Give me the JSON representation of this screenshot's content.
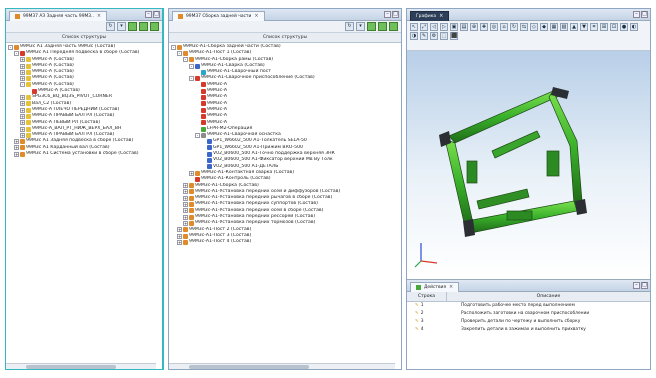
{
  "left_panel": {
    "tab_title": "99М37 АЗ Задняя часть 99М3..",
    "column_header": "Список структуры",
    "rows": [
      {
        "depth": 0,
        "icon": "orange",
        "exp": "-",
        "label": "99М3с А1 Задняя часть 99М3с (Состав)"
      },
      {
        "depth": 1,
        "icon": "red",
        "exp": "-",
        "label": "99М3с А1 Передняя подвеска в сборе (Состав)"
      },
      {
        "depth": 2,
        "icon": "yellow",
        "exp": "+",
        "label": "99М3с-А (Состав)"
      },
      {
        "depth": 2,
        "icon": "yellow",
        "exp": "+",
        "label": "99М3с-А (Состав)"
      },
      {
        "depth": 2,
        "icon": "yellow",
        "exp": "+",
        "label": "99М3с-А (Состав)"
      },
      {
        "depth": 2,
        "icon": "yellow",
        "exp": "+",
        "label": "99М3с-А (Состав)"
      },
      {
        "depth": 2,
        "icon": "yellow",
        "exp": "-",
        "label": "99М3с-А (Состав)"
      },
      {
        "depth": 3,
        "icon": "red",
        "exp": "",
        "label": "99М3с-А (Состав)"
      },
      {
        "depth": 2,
        "icon": "yellow",
        "exp": "+",
        "label": "SPG3С6_BQ_BQ3S_PIVOT_CORNER"
      },
      {
        "depth": 2,
        "icon": "yellow",
        "exp": "+",
        "label": "Вал_С2 (Состав)"
      },
      {
        "depth": 2,
        "icon": "yellow",
        "exp": "+",
        "label": "99М3с-А ПЛЕЧО ПЕРЕДНИЙ (Состав)"
      },
      {
        "depth": 2,
        "icon": "yellow",
        "exp": "+",
        "label": "99М3с-А ПРАВЫЙ БАЛ РЛ (Состав)"
      },
      {
        "depth": 2,
        "icon": "yellow",
        "exp": "+",
        "label": "99М3с-А ЛЕВЫЙ РЛ (Состав)"
      },
      {
        "depth": 2,
        "icon": "yellow",
        "exp": "+",
        "label": "99М3с-А_ВАЛ_РТ_НИЖ_ВЕРХ_БАЛ_ВН"
      },
      {
        "depth": 2,
        "icon": "yellow",
        "exp": "+",
        "label": "99М3с-А ПРАВЫЙ БАЛ РЛ (Состав)"
      },
      {
        "depth": 1,
        "icon": "orange",
        "exp": "+",
        "label": "99М3с А1 Задняя подвеска в сборе (Состав)"
      },
      {
        "depth": 1,
        "icon": "orange",
        "exp": "+",
        "label": "99М3с А1 Карданный вал (Состав)"
      },
      {
        "depth": 1,
        "icon": "orange",
        "exp": "+",
        "label": "99М3с А1 Система установки в сборе (Состав)"
      }
    ]
  },
  "mid_panel": {
    "tab_title": "99М37 Сборка задней части",
    "column_header": "Список структуры",
    "rows": [
      {
        "depth": 0,
        "icon": "orange",
        "exp": "-",
        "label": "99М3с-А1-Сборка задней части (Состав)"
      },
      {
        "depth": 1,
        "icon": "orange",
        "exp": "-",
        "label": "99М3с-А1-Пост 1 (Состав)"
      },
      {
        "depth": 2,
        "icon": "orange",
        "exp": "-",
        "label": "99М3с-А1-Сборка рамы (Состав)"
      },
      {
        "depth": 3,
        "icon": "blue",
        "exp": "-",
        "label": "99М3с-А1-Сварка (Состав)"
      },
      {
        "depth": 4,
        "icon": "cyan",
        "exp": "",
        "label": "99М3с-А1-Сварочный пост"
      },
      {
        "depth": 3,
        "icon": "red",
        "exp": "-",
        "label": "99М3с-А1-Сварочное приспособление (Состав)"
      },
      {
        "depth": 4,
        "icon": "red",
        "exp": "",
        "label": "99М3с-А"
      },
      {
        "depth": 4,
        "icon": "red",
        "exp": "",
        "label": "99М3с-А"
      },
      {
        "depth": 4,
        "icon": "red",
        "exp": "",
        "label": "99М3с-А"
      },
      {
        "depth": 4,
        "icon": "red",
        "exp": "",
        "label": "99М3с-А"
      },
      {
        "depth": 4,
        "icon": "red",
        "exp": "",
        "label": "99М3с-А"
      },
      {
        "depth": 4,
        "icon": "red",
        "exp": "",
        "label": "99М3с-А"
      },
      {
        "depth": 4,
        "icon": "red",
        "exp": "",
        "label": "99М3с-А"
      },
      {
        "depth": 4,
        "icon": "green",
        "exp": "",
        "label": "LFPR-М2-Операция"
      },
      {
        "depth": 4,
        "icon": "gray",
        "exp": "-",
        "label": "99М3с-А1-Сварочная оснастка"
      },
      {
        "depth": 5,
        "icon": "blue",
        "exp": "",
        "label": "GP1_W6602_500 А1-Толкатель SELA-50"
      },
      {
        "depth": 5,
        "icon": "blue",
        "exp": "",
        "label": "GP1_W6602_500 А1-Прижим BRO-500"
      },
      {
        "depth": 5,
        "icon": "blue",
        "exp": "",
        "label": "V02_B0600_500 А1-Точно поддержка верхняя ЗНК"
      },
      {
        "depth": 5,
        "icon": "blue",
        "exp": "",
        "label": "V02_B0600_500 А1-Фиксатор верхний Мв Ву Толк"
      },
      {
        "depth": 5,
        "icon": "blue",
        "exp": "",
        "label": "V02_B0600_500 А1-ДЕТАЛЬ"
      },
      {
        "depth": 3,
        "icon": "orange",
        "exp": "+",
        "label": "99М3с-А1-Контактная сварка (Состав)"
      },
      {
        "depth": 3,
        "icon": "red",
        "exp": "",
        "label": "99М3с-А1-Контроль (Состав)"
      },
      {
        "depth": 2,
        "icon": "orange",
        "exp": "+",
        "label": "99М3с-А1-Сборка (Состав)"
      },
      {
        "depth": 2,
        "icon": "orange",
        "exp": "+",
        "label": "99М3с-А1-Установка передних осей и диффузоров (Состав)"
      },
      {
        "depth": 2,
        "icon": "orange",
        "exp": "+",
        "label": "99М3с-А1-Установка передних рычагов в сборе (Состав)"
      },
      {
        "depth": 2,
        "icon": "orange",
        "exp": "+",
        "label": "99М3с-А1-Установка передних суппортов (Состав)"
      },
      {
        "depth": 2,
        "icon": "orange",
        "exp": "+",
        "label": "99М3с-А1-Установка передних осей в сборе (Состав)"
      },
      {
        "depth": 2,
        "icon": "orange",
        "exp": "+",
        "label": "99М3с-А1-Установка передних рессорей (Состав)"
      },
      {
        "depth": 2,
        "icon": "orange",
        "exp": "+",
        "label": "99М3с-А1-Установка передних тормозов (Состав)"
      },
      {
        "depth": 1,
        "icon": "orange",
        "exp": "+",
        "label": "99М3с-А1-Пост 2 (Состав)"
      },
      {
        "depth": 1,
        "icon": "orange",
        "exp": "+",
        "label": "99М3с-А1-Пост 3 (Состав)"
      },
      {
        "depth": 1,
        "icon": "orange",
        "exp": "+",
        "label": "99М3с-А1-Пост 4 (Состав)"
      }
    ]
  },
  "graphics": {
    "tab_title": "Графика"
  },
  "actions": {
    "tab_title": "Действия",
    "col_step": "Строка",
    "col_desc": "Описание",
    "rows": [
      {
        "num": "1",
        "desc": "Подготовить рабочее место перед выполнением"
      },
      {
        "num": "2",
        "desc": "Расположить заготовки на сварочном приспособлении"
      },
      {
        "num": "3",
        "desc": "Проверить детали по чертежу и выполнить сборку"
      },
      {
        "num": "4",
        "desc": "Закрепить детали в зажимах и выполнить прихватку"
      }
    ]
  },
  "colors": {
    "accent_cyan": "#35b8c0",
    "frame_green": "#3fb52e",
    "frame_dark": "#2f6a22"
  }
}
